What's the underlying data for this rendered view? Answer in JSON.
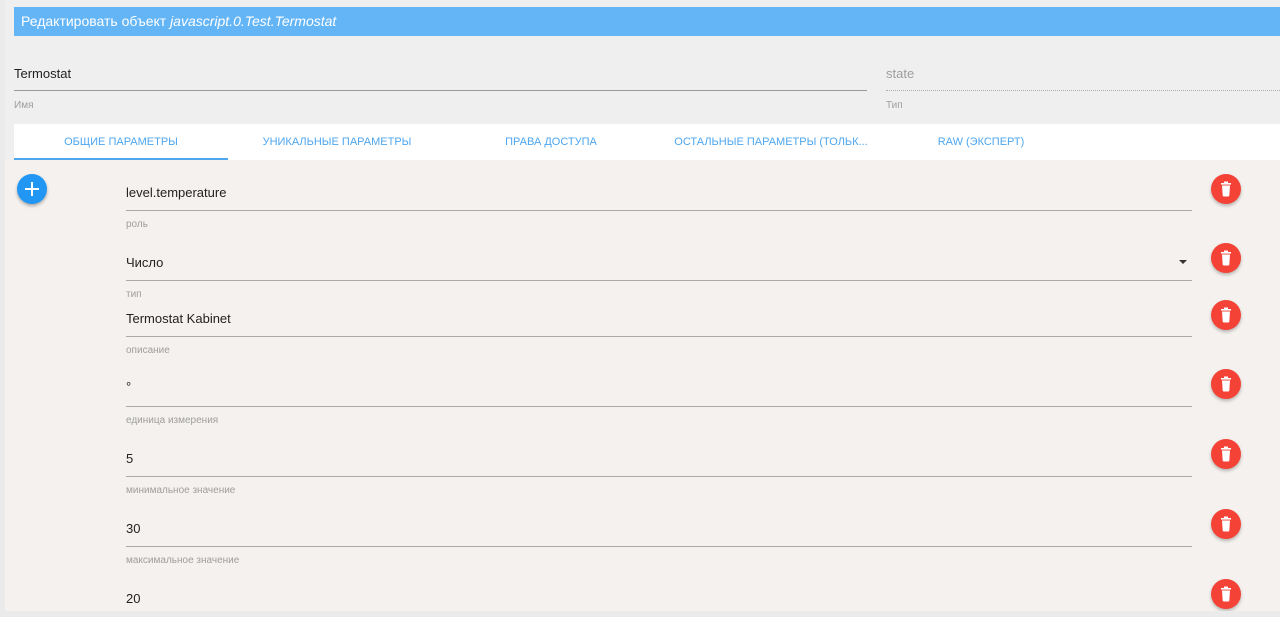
{
  "dialog": {
    "title_prefix": "Редактировать объект",
    "object_id": "javascript.0.Test.Termostat"
  },
  "header": {
    "name_value": "Termostat",
    "name_label": "Имя",
    "type_value": "state",
    "type_label": "Тип"
  },
  "tabs": [
    {
      "label": "ОБЩИЕ ПАРАМЕТРЫ",
      "active": true
    },
    {
      "label": "УНИКАЛЬНЫЕ ПАРАМЕТРЫ",
      "active": false
    },
    {
      "label": "ПРАВА ДОСТУПА",
      "active": false
    },
    {
      "label": "ОСТАЛЬНЫЕ ПАРАМЕТРЫ (ТОЛЬК...",
      "active": false
    },
    {
      "label": "RAW (ЭКСПЕРТ)",
      "active": false
    }
  ],
  "fields": [
    {
      "value": "level.temperature",
      "label": "роль"
    },
    {
      "value": "Число",
      "label": "тип"
    },
    {
      "value": "Termostat Kabinet",
      "label": "описание"
    },
    {
      "value": "°",
      "label": "единица измерения"
    },
    {
      "value": "5",
      "label": "минимальное значение"
    },
    {
      "value": "30",
      "label": "максимальное значение"
    },
    {
      "value": "20",
      "label": ""
    }
  ],
  "colors": {
    "title_bar": "#64b5f6",
    "tab_text": "#4ea6ee",
    "add_button": "#2196f3",
    "delete_button": "#f44336"
  },
  "icons": {
    "add": "plus-icon",
    "delete": "trash-icon",
    "select": "caret-down-icon"
  }
}
